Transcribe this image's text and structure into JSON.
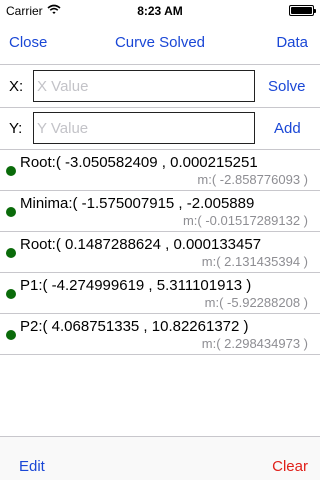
{
  "status_bar": {
    "carrier": "Carrier",
    "time": "8:23 AM",
    "wifi_icon": "wifi-icon",
    "battery_icon": "battery-icon",
    "battery_level": 1.0
  },
  "nav": {
    "left_label": "Close",
    "title": "Curve Solved",
    "right_label": "Data"
  },
  "x_row": {
    "label": "X:",
    "placeholder": "X Value",
    "value": "",
    "button": "Solve"
  },
  "y_row": {
    "label": "Y:",
    "placeholder": "Y Value",
    "value": "",
    "button": "Add"
  },
  "results": [
    {
      "text": "Root:( -3.050582409 , 0.000215251",
      "slope": "m:( -2.858776093 )"
    },
    {
      "text": "Minima:( -1.575007915 , -2.005889",
      "slope": "m:( -0.01517289132 )"
    },
    {
      "text": "Root:( 0.1487288624 , 0.000133457",
      "slope": "m:( 2.131435394 )"
    },
    {
      "text": "P1:( -4.274999619 , 5.311101913 )",
      "slope": "m:( -5.92288208 )"
    },
    {
      "text": "P2:( 4.068751335 , 10.82261372 )",
      "slope": "m:( 2.298434973 )"
    }
  ],
  "toolbar": {
    "edit_label": "Edit",
    "clear_label": "Clear"
  },
  "colors": {
    "accent": "#1a47d6",
    "destructive": "#e0201a",
    "dot": "#0a6b0a",
    "secondary_text": "#8e8e93"
  }
}
